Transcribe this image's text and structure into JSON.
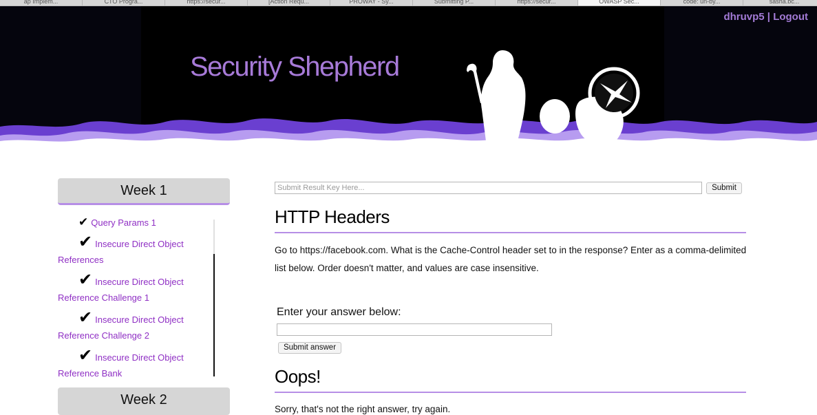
{
  "browser": {
    "tabs": [
      {
        "label": "ap Implem..."
      },
      {
        "label": "CTO Progra..."
      },
      {
        "label": "https://secur..."
      },
      {
        "label": "[Action Requ..."
      },
      {
        "label": "PROWAY - Sy..."
      },
      {
        "label": "Submitting P..."
      },
      {
        "label": "https://secur..."
      },
      {
        "label": "OWASP Sec..."
      },
      {
        "label": "code: un-by..."
      },
      {
        "label": "sasha.bc..."
      }
    ]
  },
  "header": {
    "site_title": "Security Shepherd",
    "username": "dhruvp5",
    "separator": " | ",
    "logout": "Logout"
  },
  "sidebar": {
    "week1_label": "Week 1",
    "week2_label": "Week 2",
    "check_glyph": "✔",
    "modules": [
      {
        "line1": "Query Params 1",
        "line2": ""
      },
      {
        "line1": "Insecure Direct Object",
        "line2": "References"
      },
      {
        "line1": "Insecure Direct Object",
        "line2": "Reference Challenge 1"
      },
      {
        "line1": "Insecure Direct Object",
        "line2": "Reference Challenge 2"
      },
      {
        "line1": "Insecure Direct Object",
        "line2": "Reference Bank"
      }
    ]
  },
  "main": {
    "result_key_placeholder": "Submit Result Key Here...",
    "result_key_submit": "Submit",
    "lesson_title": "HTTP Headers",
    "lesson_prompt": "Go to https://facebook.com. What is the Cache-Control header set to in the response? Enter as a comma-delimited list below. Order doesn't matter, and values are case insensitive.",
    "answer_label": "Enter your answer below:",
    "answer_value": "",
    "answer_submit": "Submit answer",
    "feedback_title": "Oops!",
    "feedback_text": "Sorry, that's not the right answer, try again."
  },
  "colors": {
    "accent": "#b68ee6",
    "title": "#a77ad8",
    "link": "#8f2fc4"
  }
}
